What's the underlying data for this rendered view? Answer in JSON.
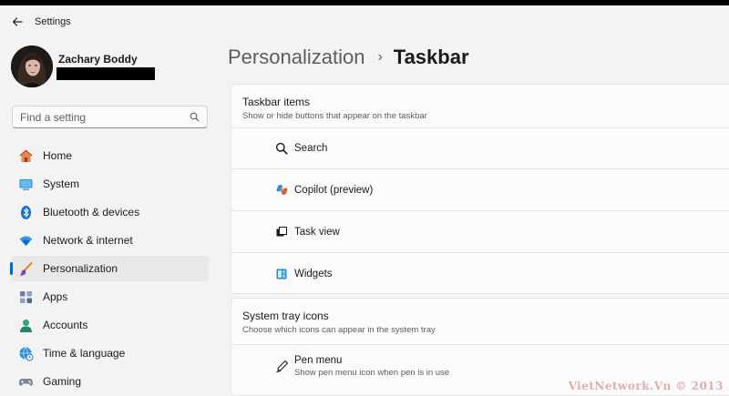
{
  "window": {
    "title": "Settings"
  },
  "user": {
    "name": "Zachary Boddy"
  },
  "search": {
    "placeholder": "Find a setting"
  },
  "sidebar": {
    "items": [
      {
        "label": "Home",
        "icon": "home-icon"
      },
      {
        "label": "System",
        "icon": "system-icon"
      },
      {
        "label": "Bluetooth & devices",
        "icon": "bluetooth-icon"
      },
      {
        "label": "Network & internet",
        "icon": "wifi-icon"
      },
      {
        "label": "Personalization",
        "icon": "brush-icon",
        "active": true
      },
      {
        "label": "Apps",
        "icon": "apps-icon"
      },
      {
        "label": "Accounts",
        "icon": "accounts-icon"
      },
      {
        "label": "Time & language",
        "icon": "globe-clock-icon"
      },
      {
        "label": "Gaming",
        "icon": "gamepad-icon"
      }
    ]
  },
  "breadcrumb": {
    "parent": "Personalization",
    "separator": "›",
    "current": "Taskbar"
  },
  "taskbar_items": {
    "title": "Taskbar items",
    "subtitle": "Show or hide buttons that appear on the taskbar",
    "rows": [
      {
        "label": "Search",
        "icon": "search-icon"
      },
      {
        "label": "Copilot (preview)",
        "icon": "copilot-icon"
      },
      {
        "label": "Task view",
        "icon": "task-view-icon"
      },
      {
        "label": "Widgets",
        "icon": "widgets-icon"
      }
    ]
  },
  "system_tray": {
    "title": "System tray icons",
    "subtitle": "Choose which icons can appear in the system tray",
    "rows": [
      {
        "label": "Pen menu",
        "description": "Show pen menu icon when pen is in use",
        "icon": "pen-icon"
      }
    ]
  },
  "watermark": "VietNetwork.Vn © 2013",
  "colors": {
    "accent": "#0067c0",
    "background": "#f3f3f3",
    "card": "#fbfbfb"
  }
}
